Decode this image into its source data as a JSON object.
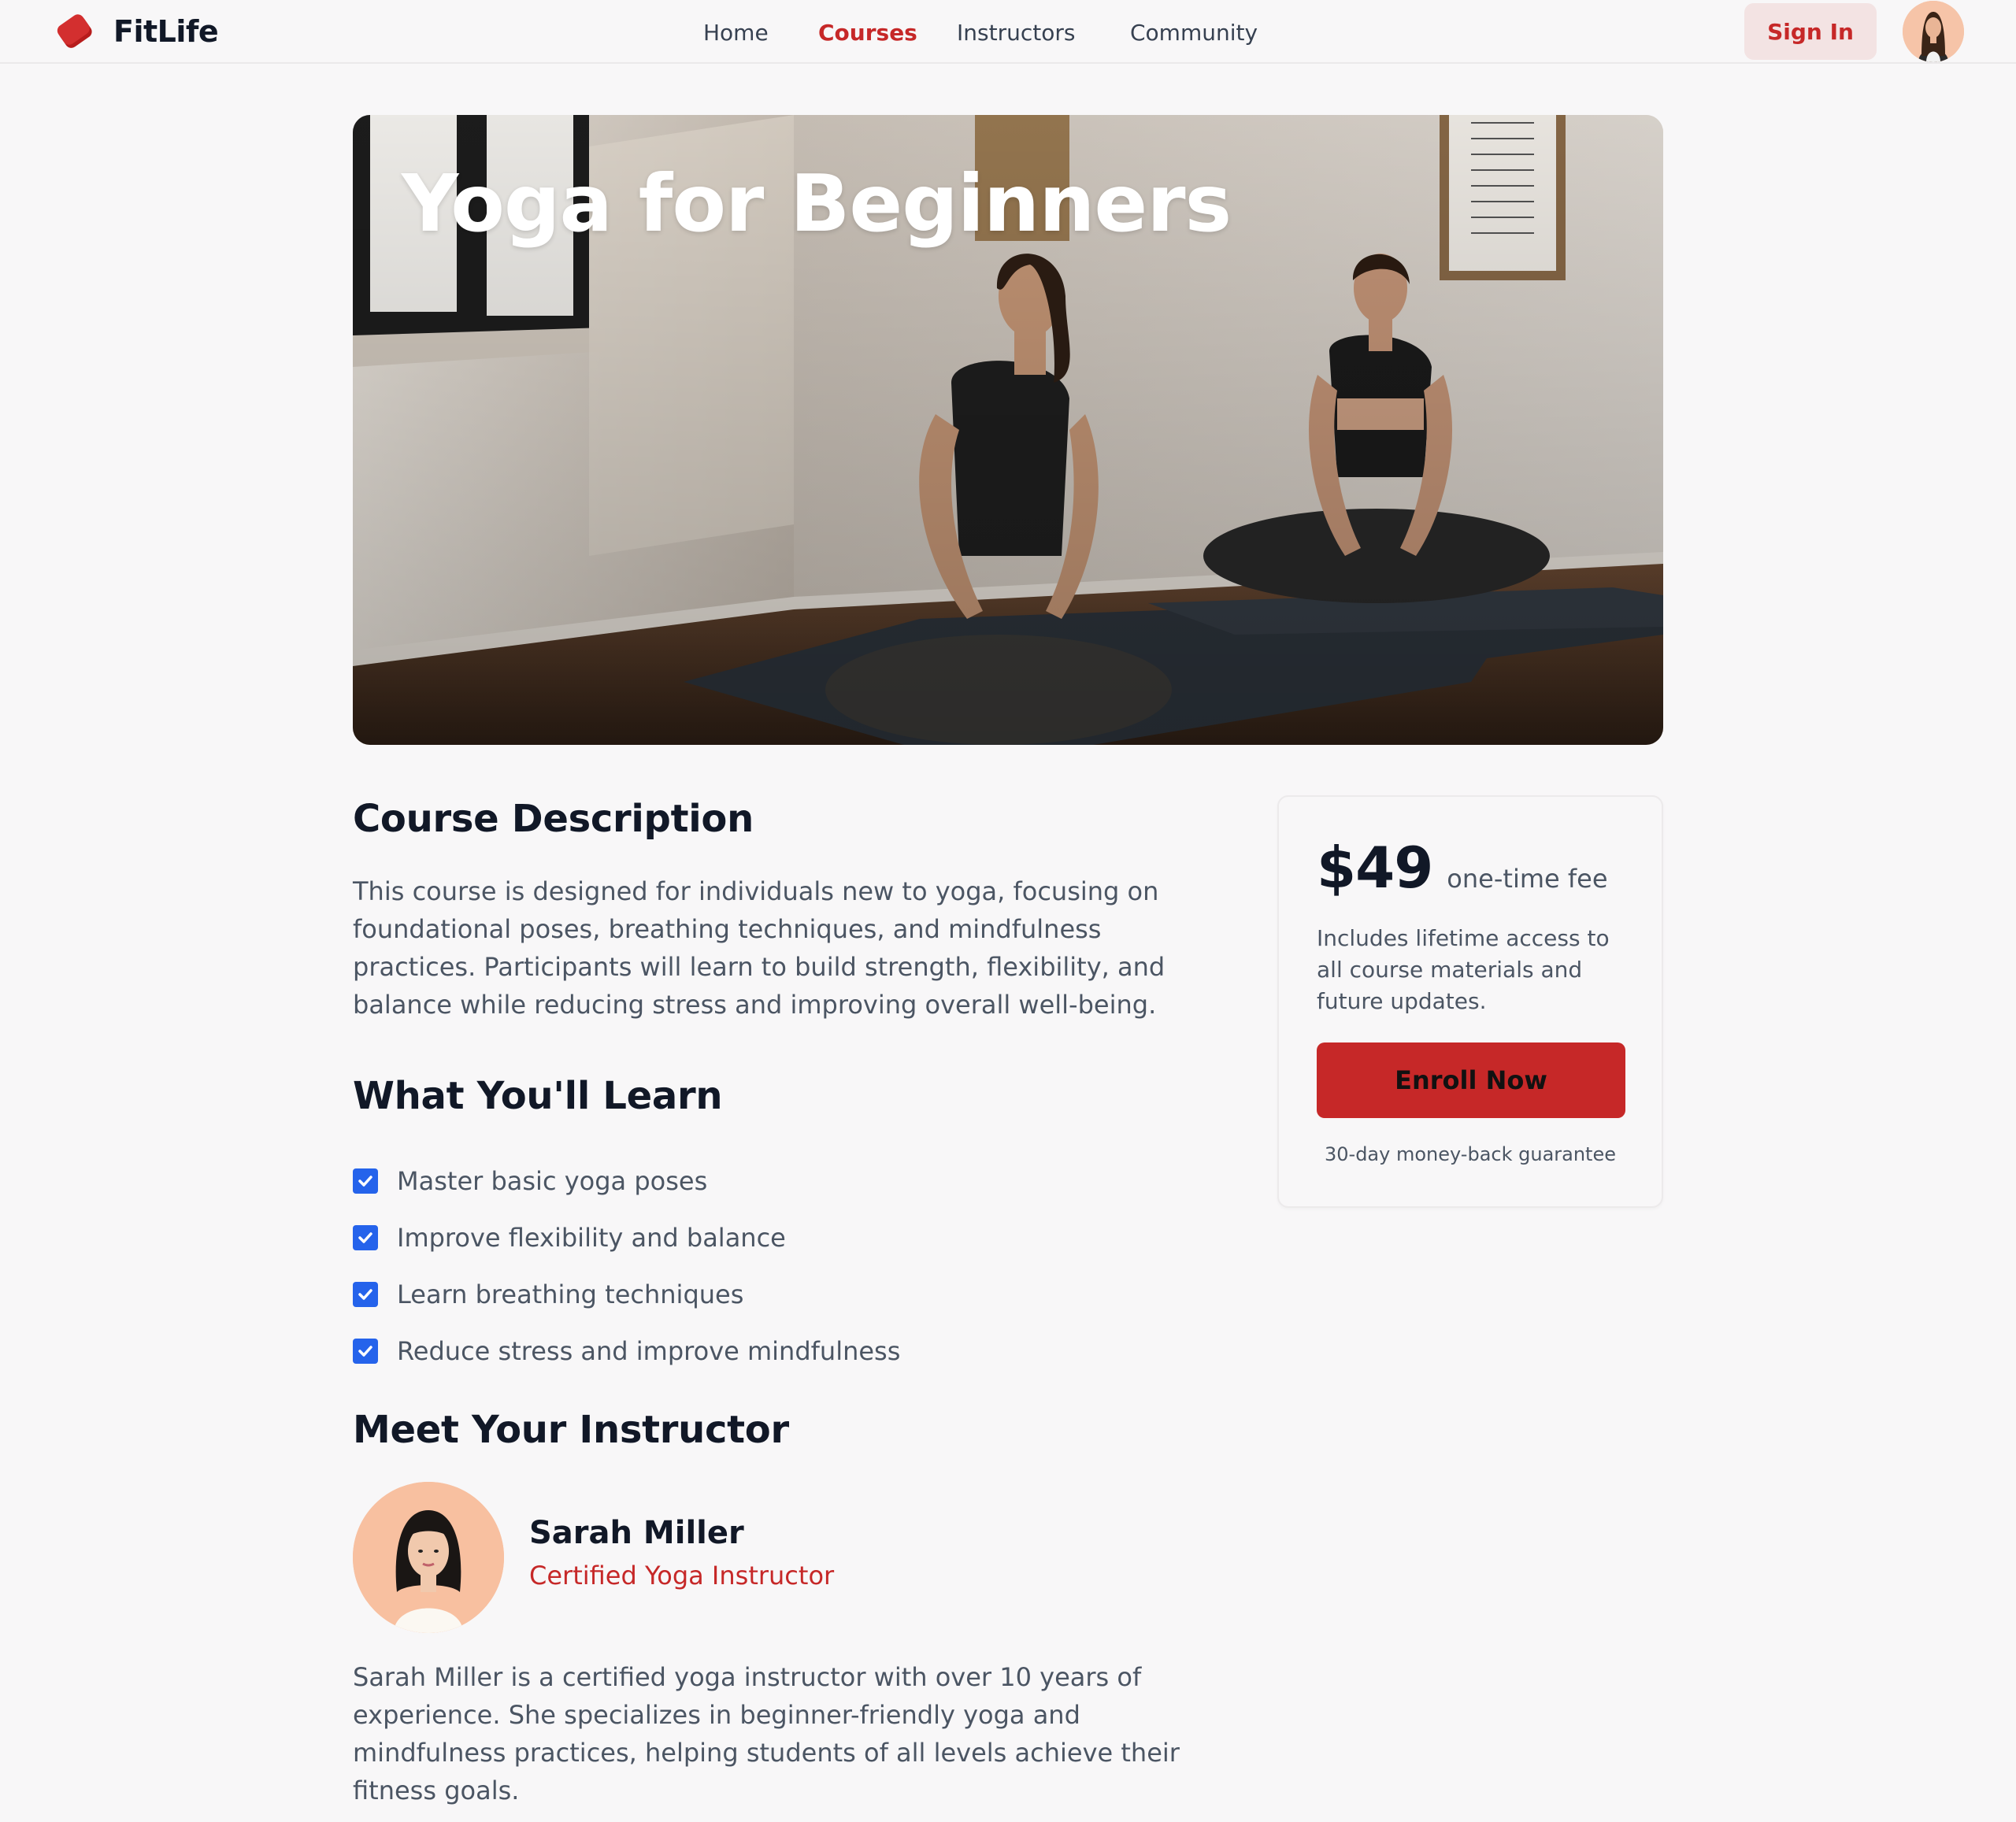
{
  "brand": {
    "name": "FitLife",
    "logo_icon": "tag-logo-icon",
    "accent": "#c62828"
  },
  "nav": {
    "items": [
      {
        "label": "Home",
        "active": false
      },
      {
        "label": "Courses",
        "active": true
      },
      {
        "label": "Instructors",
        "active": false
      },
      {
        "label": "Community",
        "active": false
      }
    ]
  },
  "header": {
    "sign_in_label": "Sign In"
  },
  "hero": {
    "title": "Yoga for Beginners"
  },
  "course": {
    "description_title": "Course Description",
    "description": "This course is designed for individuals new to yoga, focusing on foundational poses, breathing techniques, and mindfulness practices. Participants will learn to build strength, flexibility, and balance while reducing stress and improving overall well-being.",
    "learn_title": "What You'll Learn",
    "learn_items": [
      "Master basic yoga poses",
      "Improve flexibility and balance",
      "Learn breathing techniques",
      "Reduce stress and improve mindfulness"
    ]
  },
  "instructor": {
    "section_title": "Meet Your Instructor",
    "name": "Sarah Miller",
    "role": "Certified Yoga Instructor",
    "bio": "Sarah Miller is a certified yoga instructor with over 10 years of experience. She specializes in beginner-friendly yoga and mindfulness practices, helping students of all levels achieve their fitness goals."
  },
  "pricing": {
    "price": "$49",
    "price_note": "one-time fee",
    "includes": "Includes lifetime access to all course materials and future updates.",
    "enroll_label": "Enroll Now",
    "guarantee": "30-day money-back guarantee"
  },
  "colors": {
    "accent_red": "#c62828",
    "check_blue": "#2563eb",
    "page_bg": "#f8f7f8",
    "sign_in_bg": "#f3e3e3"
  }
}
